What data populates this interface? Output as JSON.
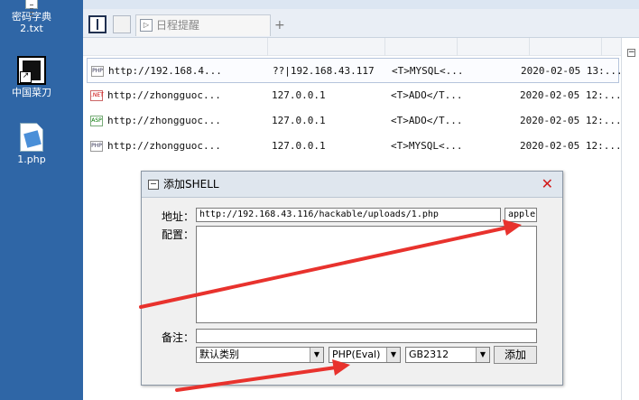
{
  "desktop": {
    "icons": [
      {
        "label": "密码字典\n2.txt",
        "icon": "text-file-icon"
      },
      {
        "label": "中国菜刀",
        "icon": "chopper-shortcut-icon"
      },
      {
        "label": "1.php",
        "icon": "php-file-icon"
      }
    ],
    "icon_line1": "密码字典",
    "icon_line2": "2.txt",
    "icon2_label": "中国菜刀",
    "icon3_label": "1.php"
  },
  "tabs": {
    "active_tab": "日程提醒",
    "add": "+"
  },
  "table": {
    "rows": [
      {
        "type": "PHP",
        "url": "http://192.168.4...",
        "ip": "??|192.168.43.117",
        "config": "<T>MYSQL<...",
        "time": "2020-02-05 13:..."
      },
      {
        "type": ".NET",
        "url": "http://zhongguoc...",
        "ip": "127.0.0.1",
        "config": "<T>ADO</T...",
        "time": "2020-02-05 12:..."
      },
      {
        "type": "ASP",
        "url": "http://zhongguoc...",
        "ip": "127.0.0.1",
        "config": "<T>ADO</T...",
        "time": "2020-02-05 12:..."
      },
      {
        "type": "PHP",
        "url": "http://zhongguoc...",
        "ip": "127.0.0.1",
        "config": "<T>MYSQL<...",
        "time": "2020-02-05 12:..."
      }
    ]
  },
  "dialog": {
    "title": "添加SHELL",
    "close": "✕",
    "address_label": "地址：",
    "address_value": "http://192.168.43.116/hackable/uploads/1.php",
    "password_value": "apple",
    "config_label": "配置：",
    "config_value": "",
    "note_label": "备注：",
    "note_value": "",
    "category_value": "默认类别",
    "script_type_value": "PHP(Eval)",
    "encoding_value": "GB2312",
    "add_button": "添加"
  },
  "colors": {
    "desktop_bg": "#2f66a6",
    "annotation_arrow": "#e8322d",
    "close_red": "#d21a1a"
  }
}
